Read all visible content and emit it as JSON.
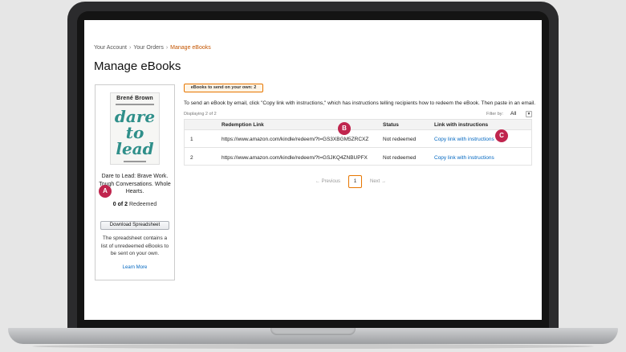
{
  "breadcrumb": {
    "items": [
      "Your Account",
      "Your Orders"
    ],
    "current": "Manage eBooks",
    "separator": "›"
  },
  "page": {
    "title": "Manage eBooks"
  },
  "book": {
    "cover_author": "Brené Brown",
    "cover_title": "dare\nto\nlead",
    "title": "Dare to Lead: Brave Work. Tough Conversations. Whole Hearts.",
    "redeemed_count": "0 of 2",
    "redeemed_label": "Redeemed",
    "cover_color": "#2f8f8a"
  },
  "sidebar": {
    "download_label": "Download Spreadsheet",
    "spreadsheet_description": "The spreadsheet contains a list of unredeemed eBooks to be sent on your own.",
    "learn_more": "Learn More"
  },
  "tab": {
    "label": "eBooks to send on your own: 2"
  },
  "instructions": "To send an eBook by email, click \"Copy link with instructions,\" which has instructions telling recipients how to redeem the eBook. Then paste in an email.",
  "list": {
    "displaying": "Displaying 2 of 2",
    "filter_label": "Filter by:",
    "filter_value": "All"
  },
  "table": {
    "headers": [
      "Redemption Link",
      "Status",
      "Link with instructions"
    ],
    "rows": [
      {
        "index": "1",
        "link": "https://www.amazon.com/kindle/redeem/?t=GS3XBGM5ZRCXZ",
        "status": "Not redeemed",
        "action": "Copy link with instructions"
      },
      {
        "index": "2",
        "link": "https://www.amazon.com/kindle/redeem/?t=GSJKQ4ZNBUPFX",
        "status": "Not redeemed",
        "action": "Copy link with instructions"
      }
    ]
  },
  "pagination": {
    "prev": "← Previous",
    "current": "1",
    "next": "Next →"
  },
  "markers": {
    "a": "A",
    "b": "B",
    "c": "C"
  },
  "colors": {
    "accent": "#e77600",
    "link": "#0066c0",
    "marker": "#c0254e",
    "breadcrumb_current": "#c45500"
  },
  "icons": {
    "filter_dropdown": "chevron-down-icon"
  }
}
